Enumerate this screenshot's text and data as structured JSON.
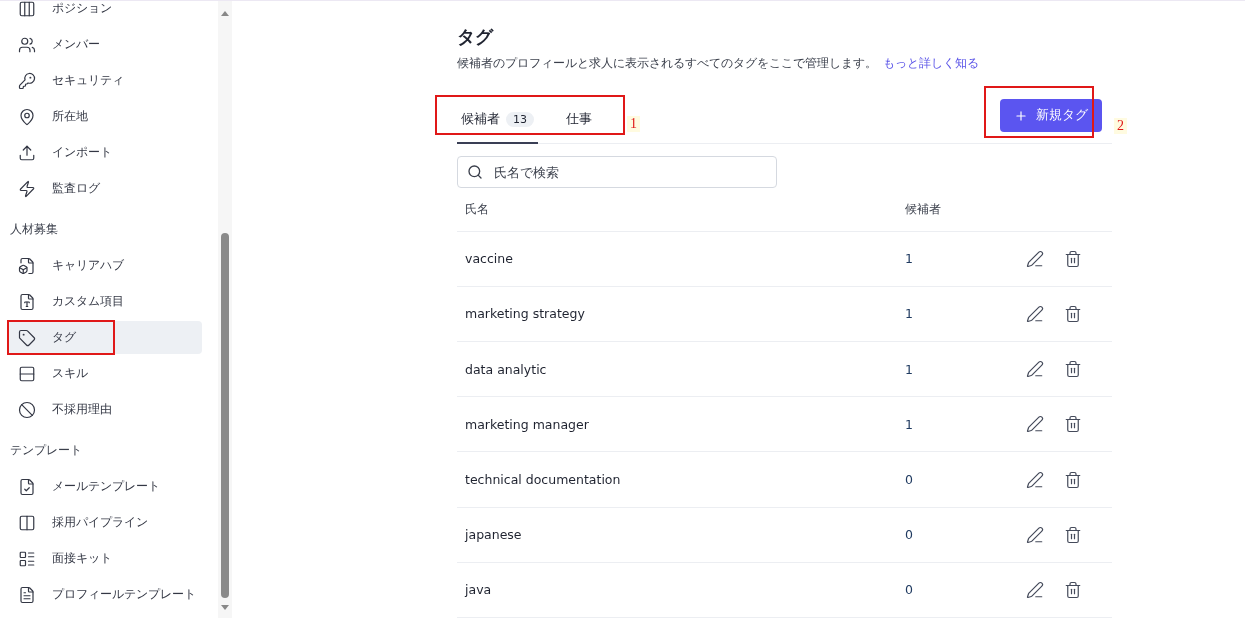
{
  "sidebar": {
    "sections": [
      {
        "items": [
          {
            "label": "ポジション",
            "selected": false,
            "marked": false
          },
          {
            "label": "メンバー",
            "selected": false,
            "marked": false
          },
          {
            "label": "セキュリティ",
            "selected": false,
            "marked": false
          },
          {
            "label": "所在地",
            "selected": false,
            "marked": false
          },
          {
            "label": "インポート",
            "selected": false,
            "marked": false
          },
          {
            "label": "監査ログ",
            "selected": false,
            "marked": false
          }
        ]
      },
      {
        "title": "人材募集",
        "items": [
          {
            "label": "キャリアハブ",
            "selected": false,
            "marked": false
          },
          {
            "label": "カスタム項目",
            "selected": false,
            "marked": false
          },
          {
            "label": "タグ",
            "selected": true,
            "marked": true
          },
          {
            "label": "スキル",
            "selected": false,
            "marked": false
          },
          {
            "label": "不採用理由",
            "selected": false,
            "marked": false
          }
        ]
      },
      {
        "title": "テンプレート",
        "items": [
          {
            "label": "メールテンプレート",
            "selected": false,
            "marked": false
          },
          {
            "label": "採用パイプライン",
            "selected": false,
            "marked": false
          },
          {
            "label": "面接キット",
            "selected": false,
            "marked": false
          },
          {
            "label": "プロフィールテンプレート",
            "selected": false,
            "marked": false
          }
        ]
      }
    ]
  },
  "page": {
    "title": "タグ",
    "description": "候補者のプロフィールと求人に表示されるすべてのタグをここで管理します。",
    "learn_more": "もっと詳しく知る"
  },
  "tabs": {
    "annotation": "1",
    "items": [
      {
        "label": "候補者",
        "count": "13",
        "selected": true
      },
      {
        "label": "仕事",
        "selected": false
      }
    ]
  },
  "new_tag_button": {
    "label": "新規タグ",
    "annotation": "2"
  },
  "search": {
    "placeholder": "氏名で検索"
  },
  "table": {
    "columns": [
      "氏名",
      "候補者"
    ],
    "rows": [
      {
        "name": "vaccine",
        "count": "1"
      },
      {
        "name": "marketing strategy",
        "count": "1"
      },
      {
        "name": "data analytic",
        "count": "1"
      },
      {
        "name": "marketing manager",
        "count": "1"
      },
      {
        "name": "technical documentation",
        "count": "0"
      },
      {
        "name": "japanese",
        "count": "0"
      },
      {
        "name": "java",
        "count": "0"
      }
    ]
  }
}
